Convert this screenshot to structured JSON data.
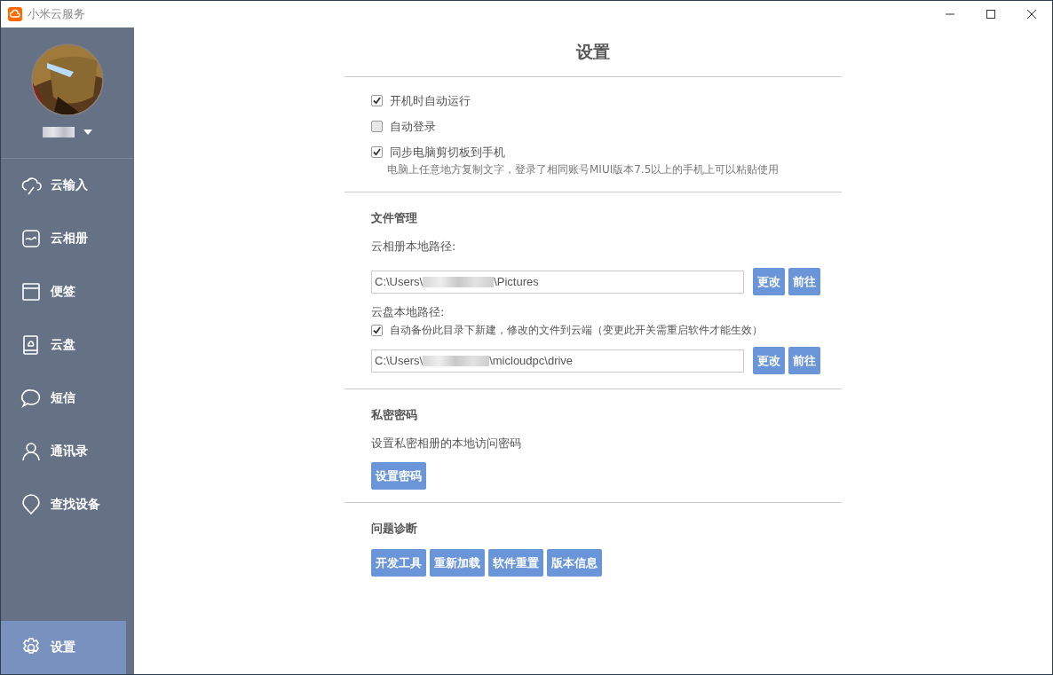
{
  "window": {
    "title": "小米云服务"
  },
  "sidebar": {
    "items": [
      {
        "label": "云输入",
        "kind": "input",
        "selected": false
      },
      {
        "label": "云相册",
        "kind": "album",
        "selected": false
      },
      {
        "label": "便签",
        "kind": "notes",
        "selected": false
      },
      {
        "label": "云盘",
        "kind": "drive",
        "selected": false
      },
      {
        "label": "短信",
        "kind": "messages",
        "selected": false
      },
      {
        "label": "通讯录",
        "kind": "contacts",
        "selected": false
      },
      {
        "label": "查找设备",
        "kind": "finder",
        "selected": false
      }
    ],
    "settings_item": {
      "label": "设置",
      "selected": true
    }
  },
  "page": {
    "title": "设置",
    "general": [
      {
        "label": "开机时自动运行",
        "checked": true
      },
      {
        "label": "自动登录",
        "checked": false
      },
      {
        "label": "同步电脑剪切板到手机",
        "checked": true,
        "hint": "电脑上任意地方复制文字，登录了相同账号MIUI版本7.5以上的手机上可以粘贴使用"
      }
    ],
    "files": {
      "title": "文件管理",
      "album_label": "云相册本地路径:",
      "album_path": {
        "prefix": "C:\\Users\\",
        "suffix": "\\Pictures"
      },
      "album_buttons": [
        "更改",
        "前往"
      ],
      "drive_label": "云盘本地路径:",
      "backup": {
        "label": "自动备份此目录下新建，修改的文件到云端（变更此开关需重启软件才能生效）",
        "checked": true
      },
      "drive_path": {
        "prefix": "C:\\Users\\",
        "suffix": "\\micloudpc\\drive"
      },
      "drive_buttons": [
        "更改",
        "前往"
      ]
    },
    "privacy": {
      "title": "私密密码",
      "text": "设置私密相册的本地访问密码",
      "button": "设置密码"
    },
    "diagnosis": {
      "title": "问题诊断",
      "buttons": [
        "开发工具",
        "重新加载",
        "软件重置",
        "版本信息"
      ]
    }
  }
}
